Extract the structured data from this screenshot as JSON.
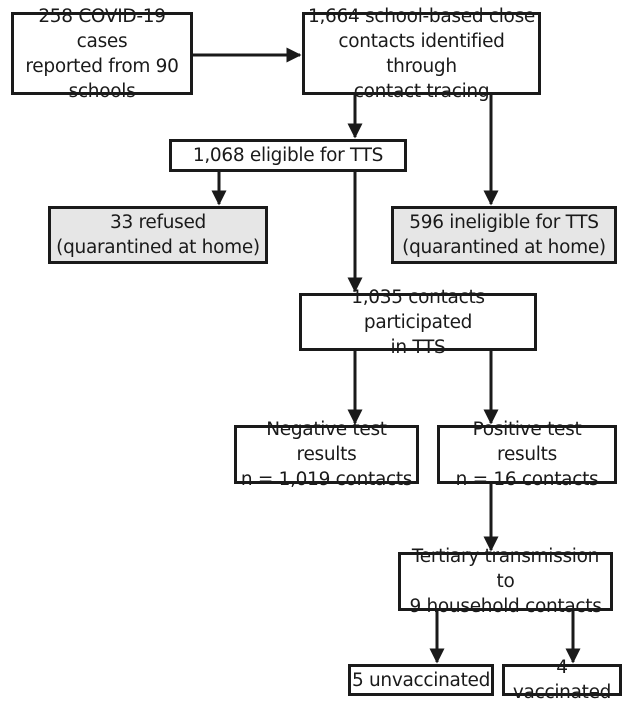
{
  "diagram": {
    "type": "flowchart",
    "colors": {
      "line": "#1a1a1a",
      "box_fill": "#ffffff",
      "excluded_fill": "#e6e6e6"
    },
    "nodes": [
      {
        "id": "cases",
        "lines": [
          "258 COVID-19 cases",
          "reported from 90",
          "schools"
        ],
        "style": "plain"
      },
      {
        "id": "close_contacts",
        "lines": [
          "1,664 school-based close",
          "contacts identified through",
          "contact tracing"
        ],
        "style": "plain"
      },
      {
        "id": "eligible",
        "lines": [
          "1,068 eligible for TTS"
        ],
        "style": "plain"
      },
      {
        "id": "refused",
        "lines": [
          "33 refused",
          "(quarantined at home)"
        ],
        "style": "excluded"
      },
      {
        "id": "ineligible",
        "lines": [
          "596 ineligible for TTS",
          "(quarantined at home)"
        ],
        "style": "excluded"
      },
      {
        "id": "participated",
        "lines": [
          "1,035 contacts participated",
          "in TTS"
        ],
        "style": "plain"
      },
      {
        "id": "negative",
        "lines": [
          "Negative test results",
          "n = 1,019 contacts"
        ],
        "style": "plain"
      },
      {
        "id": "positive",
        "lines": [
          "Positive test results",
          "n = 16 contacts"
        ],
        "style": "plain"
      },
      {
        "id": "tertiary",
        "lines": [
          "Tertiary transmission to",
          "9 household contacts"
        ],
        "style": "plain"
      },
      {
        "id": "unvaccinated",
        "lines": [
          "5 unvaccinated"
        ],
        "style": "plain"
      },
      {
        "id": "vaccinated",
        "lines": [
          "4 vaccinated"
        ],
        "style": "plain"
      }
    ],
    "edges": [
      {
        "from": "cases",
        "to": "close_contacts"
      },
      {
        "from": "close_contacts",
        "to": "eligible"
      },
      {
        "from": "close_contacts",
        "to": "ineligible"
      },
      {
        "from": "eligible",
        "to": "refused"
      },
      {
        "from": "eligible",
        "to": "participated"
      },
      {
        "from": "participated",
        "to": "negative"
      },
      {
        "from": "participated",
        "to": "positive"
      },
      {
        "from": "positive",
        "to": "tertiary"
      },
      {
        "from": "tertiary",
        "to": "unvaccinated"
      },
      {
        "from": "tertiary",
        "to": "vaccinated"
      }
    ]
  }
}
